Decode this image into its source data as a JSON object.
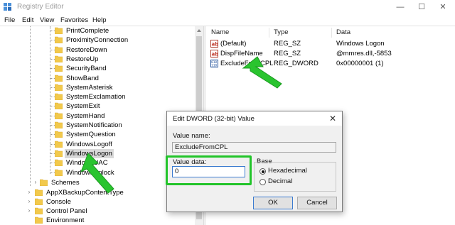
{
  "window": {
    "title": "Registry Editor",
    "minimize_glyph": "—",
    "maximize_glyph": "☐",
    "close_glyph": "✕"
  },
  "menu": [
    "File",
    "Edit",
    "View",
    "Favorites",
    "Help"
  ],
  "tree": {
    "sounds": [
      "PrintComplete",
      "ProximityConnection",
      "RestoreDown",
      "RestoreUp",
      "SecurityBand",
      "ShowBand",
      "SystemAsterisk",
      "SystemExclamation",
      "SystemExit",
      "SystemHand",
      "SystemNotification",
      "SystemQuestion",
      "WindowsLogoff",
      "WindowsLogon",
      "WindowsUAC",
      "WindowsUnlock"
    ],
    "selected": "WindowsLogon",
    "schemes": "Schemes",
    "top_level": [
      "AppXBackupContentType",
      "Console",
      "Control Panel",
      "Environment"
    ]
  },
  "list": {
    "headers": {
      "name": "Name",
      "type": "Type",
      "data": "Data"
    },
    "rows": [
      {
        "name": "(Default)",
        "type": "REG_SZ",
        "data": "Windows Logon",
        "icon": "string-value-icon"
      },
      {
        "name": "DispFileName",
        "type": "REG_SZ",
        "data": "@mmres.dll,-5853",
        "icon": "string-value-icon"
      },
      {
        "name": "ExcludeFromCPL",
        "type": "REG_DWORD",
        "data": "0x00000001 (1)",
        "icon": "binary-value-icon"
      }
    ]
  },
  "dialog": {
    "title": "Edit DWORD (32-bit) Value",
    "close_glyph": "✕",
    "value_name_label": "Value name:",
    "value_name": "ExcludeFromCPL",
    "value_data_label": "Value data:",
    "value_data": "0",
    "base_label": "Base",
    "base_options": [
      "Hexadecimal",
      "Decimal"
    ],
    "base_selected": "Hexadecimal",
    "ok_label": "OK",
    "cancel_label": "Cancel"
  },
  "colors": {
    "annotation_green": "#22c42a",
    "selection_gray": "#d9d9d9",
    "folder_yellow": "#f2c94c",
    "focus_blue": "#3b7bd0"
  }
}
